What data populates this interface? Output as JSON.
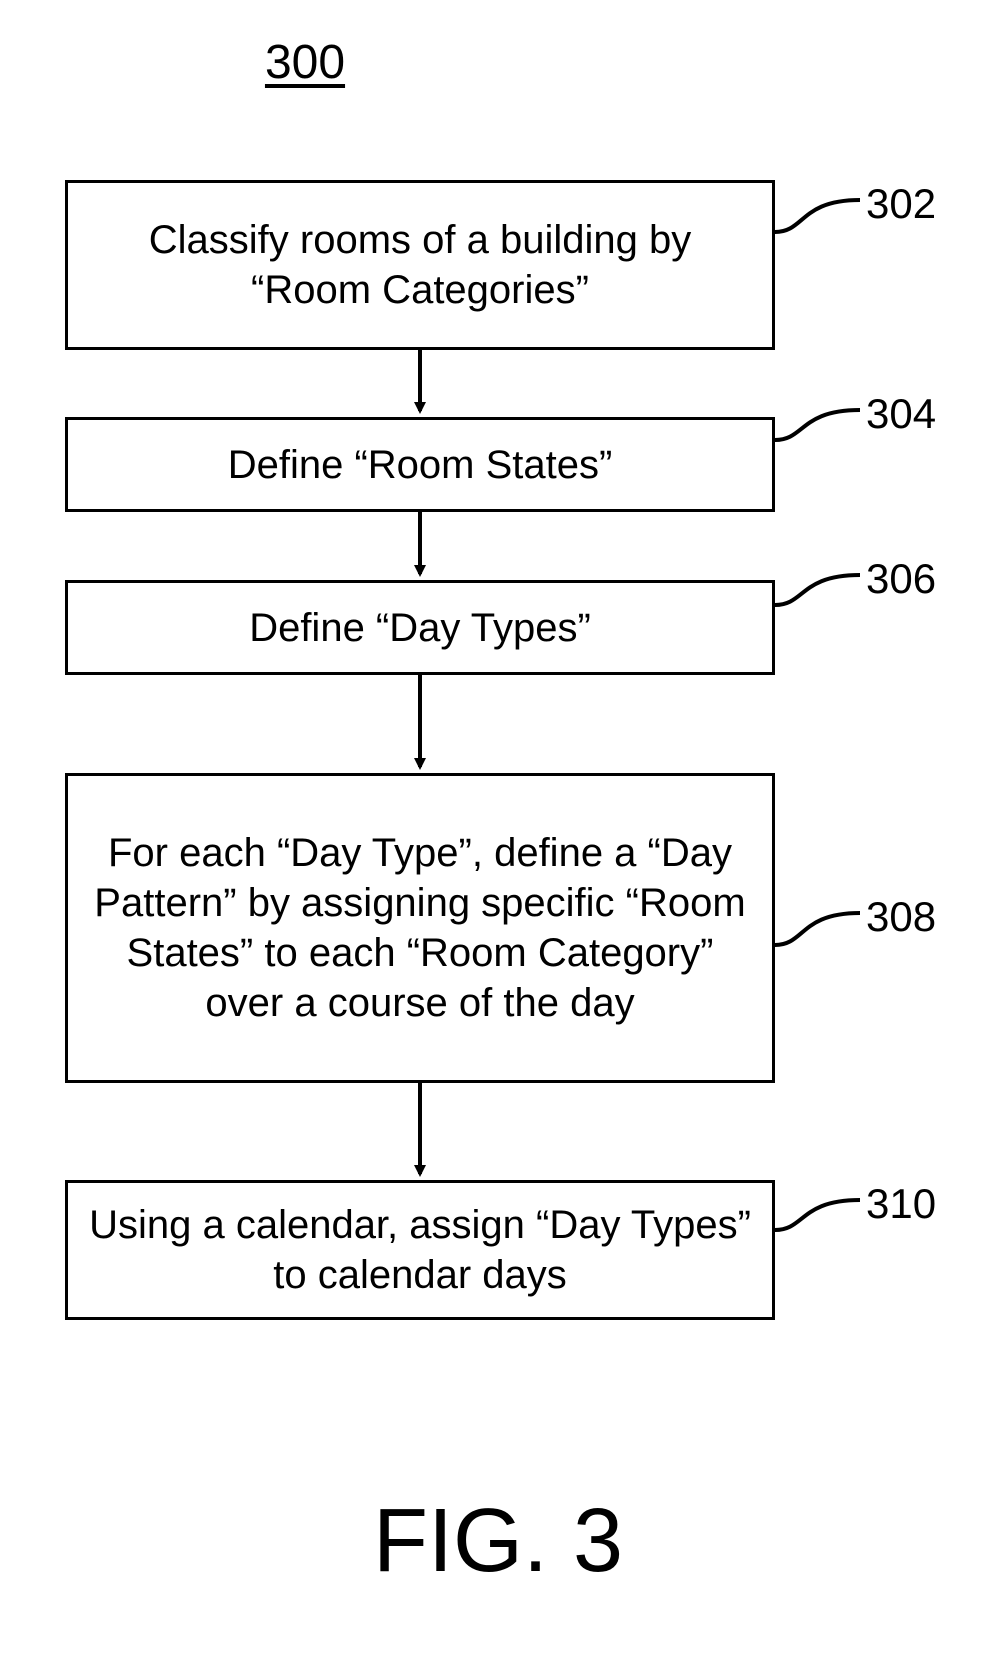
{
  "chart_data": {
    "type": "flowchart",
    "figure_number": "300",
    "figure_label": "FIG. 3",
    "steps": [
      {
        "ref": "302",
        "text": "Classify rooms of a building by “Room Categories”"
      },
      {
        "ref": "304",
        "text": "Define “Room States”"
      },
      {
        "ref": "306",
        "text": "Define “Day Types”"
      },
      {
        "ref": "308",
        "text": "For each “Day Type”, define a “Day Pattern” by assigning specific “Room States” to each “Room Category” over a course of the day"
      },
      {
        "ref": "310",
        "text": "Using a calendar, assign “Day Types” to calendar days"
      }
    ],
    "edges": [
      {
        "from": "302",
        "to": "304"
      },
      {
        "from": "304",
        "to": "306"
      },
      {
        "from": "306",
        "to": "308"
      },
      {
        "from": "308",
        "to": "310"
      }
    ]
  }
}
